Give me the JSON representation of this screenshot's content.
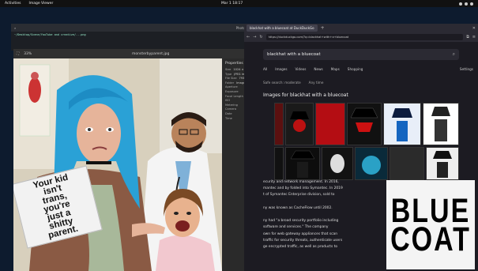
{
  "topbar": {
    "activities": "Activities",
    "app_name": "Image Viewer",
    "clock": "Mar 1 18:17"
  },
  "terminal": {
    "tab_label": "Photo",
    "path_line": "~/Desktop/Scene/YouTube and creative/...png"
  },
  "viewer": {
    "zoom": "33%",
    "filename": "monsterbyparent.jpg",
    "sign_text": "Your kid\nisn't\ntrans,\nyou're\njust a\nshitty\nparent.",
    "properties": {
      "title": "Properties",
      "rows": [
        "Size",
        "Type",
        "File Size",
        "Folder",
        "Aperture",
        "Exposure",
        "Focal Length",
        "ISO",
        "Metering",
        "Camera",
        "Date",
        "Time"
      ],
      "values": [
        "1024 × 1024 pixels",
        "JPEG image",
        "793.3 kB",
        "Images",
        "",
        "",
        "",
        "",
        "",
        "",
        "",
        ""
      ]
    }
  },
  "browser": {
    "tab_title": "blackhat with a bluecoat at DuckDuckGo",
    "url": "https://duckduckgo.com/?q=blackhat+with+a+bluecoat",
    "search_query": "blackhat with a bluecoat",
    "filters": [
      "All",
      "Images",
      "Videos",
      "News",
      "Maps",
      "Shopping"
    ],
    "settings": "Settings",
    "subfilters": [
      "Safe search: moderate",
      "Any time"
    ],
    "results_heading": "Images for blackhat with a bluecoat",
    "article_lines": [
      "ecurity and network management. In 2016,",
      "mantec and by folded into Symantec. In 2019",
      "t of Symantec Enterprise division, sold to",
      "",
      "ny was known as CacheFlow until 2002.",
      "",
      "ny had \"a broad security portfolio including",
      "software and services.\" The company",
      "own for web gateway appliances that scan",
      "traffic for security threats, authenticate users",
      "ge encrypted traffic, as well as products to"
    ],
    "logo_lines": [
      "BLUE",
      "COAT"
    ]
  },
  "colors": {
    "link": "#6aa8ff",
    "browser_bg": "#1c1b22",
    "viewer_bg": "#242424"
  }
}
